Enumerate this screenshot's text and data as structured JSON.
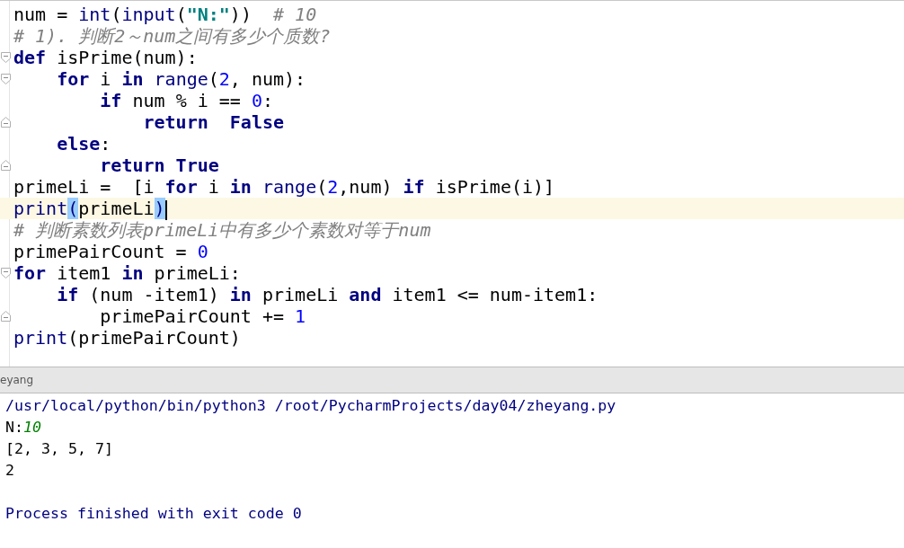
{
  "editor": {
    "lines": [
      {
        "kind": "plain",
        "tokens": [
          {
            "text": "num = ",
            "kind": "plain"
          },
          {
            "text": "int",
            "kind": "builtin"
          },
          {
            "text": "(",
            "kind": "plain"
          },
          {
            "text": "input",
            "kind": "builtin"
          },
          {
            "text": "(",
            "kind": "plain"
          },
          {
            "text": "\"N:\"",
            "kind": "string"
          },
          {
            "text": "))  ",
            "kind": "plain"
          },
          {
            "text": "# 10",
            "kind": "comment"
          }
        ]
      },
      {
        "kind": "plain",
        "tokens": [
          {
            "text": "# 1). 判断2～num之间有多少个质数?",
            "kind": "comment"
          }
        ]
      },
      {
        "kind": "fold-start",
        "tokens": [
          {
            "text": "def",
            "kind": "keyword"
          },
          {
            "text": " isPrime(num):",
            "kind": "plain"
          }
        ]
      },
      {
        "kind": "fold-start",
        "tokens": [
          {
            "text": "    for",
            "kind": "keyword"
          },
          {
            "text": " i ",
            "kind": "plain"
          },
          {
            "text": "in",
            "kind": "keyword"
          },
          {
            "text": " range",
            "kind": "builtin"
          },
          {
            "text": "(",
            "kind": "plain"
          },
          {
            "text": "2",
            "kind": "number"
          },
          {
            "text": ", num):",
            "kind": "plain"
          }
        ]
      },
      {
        "kind": "plain",
        "tokens": [
          {
            "text": "        if",
            "kind": "keyword"
          },
          {
            "text": " num % i == ",
            "kind": "plain"
          },
          {
            "text": "0",
            "kind": "number"
          },
          {
            "text": ":",
            "kind": "plain"
          }
        ]
      },
      {
        "kind": "fold-end",
        "tokens": [
          {
            "text": "            return",
            "kind": "keyword"
          },
          {
            "text": "  False",
            "kind": "keyword"
          }
        ]
      },
      {
        "kind": "plain",
        "tokens": [
          {
            "text": "    else",
            "kind": "keyword"
          },
          {
            "text": ":",
            "kind": "plain"
          }
        ]
      },
      {
        "kind": "fold-end",
        "tokens": [
          {
            "text": "        return",
            "kind": "keyword"
          },
          {
            "text": " True",
            "kind": "keyword"
          }
        ]
      },
      {
        "kind": "plain",
        "tokens": [
          {
            "text": "primeLi =  [i ",
            "kind": "plain"
          },
          {
            "text": "for",
            "kind": "keyword"
          },
          {
            "text": " i ",
            "kind": "plain"
          },
          {
            "text": "in",
            "kind": "keyword"
          },
          {
            "text": " range",
            "kind": "builtin"
          },
          {
            "text": "(",
            "kind": "plain"
          },
          {
            "text": "2",
            "kind": "number"
          },
          {
            "text": ",num) ",
            "kind": "plain"
          },
          {
            "text": "if",
            "kind": "keyword"
          },
          {
            "text": " isPrime(i)]",
            "kind": "plain"
          }
        ]
      },
      {
        "kind": "plain",
        "current": true,
        "tokens": [
          {
            "text": "print",
            "kind": "builtin"
          },
          {
            "text": "(",
            "kind": "brace-match"
          },
          {
            "text": "primeLi",
            "kind": "plain"
          },
          {
            "text": ")",
            "kind": "brace-match"
          }
        ]
      },
      {
        "kind": "plain",
        "tokens": [
          {
            "text": "# 判断素数列表primeLi中有多少个素数对等于num",
            "kind": "comment"
          }
        ]
      },
      {
        "kind": "plain",
        "tokens": [
          {
            "text": "primePairCount = ",
            "kind": "plain"
          },
          {
            "text": "0",
            "kind": "number"
          }
        ]
      },
      {
        "kind": "fold-start",
        "tokens": [
          {
            "text": "for",
            "kind": "keyword"
          },
          {
            "text": " item1 ",
            "kind": "plain"
          },
          {
            "text": "in",
            "kind": "keyword"
          },
          {
            "text": " primeLi:",
            "kind": "plain"
          }
        ]
      },
      {
        "kind": "plain",
        "tokens": [
          {
            "text": "    if",
            "kind": "keyword"
          },
          {
            "text": " (num -item1) ",
            "kind": "plain"
          },
          {
            "text": "in",
            "kind": "keyword"
          },
          {
            "text": " primeLi ",
            "kind": "plain"
          },
          {
            "text": "and",
            "kind": "keyword"
          },
          {
            "text": " item1 <= num-item1:",
            "kind": "plain"
          }
        ]
      },
      {
        "kind": "fold-end",
        "tokens": [
          {
            "text": "        primePairCount += ",
            "kind": "plain"
          },
          {
            "text": "1",
            "kind": "number"
          }
        ]
      },
      {
        "kind": "plain",
        "tokens": [
          {
            "text": "print",
            "kind": "builtin"
          },
          {
            "text": "(primePairCount)",
            "kind": "plain"
          }
        ]
      }
    ]
  },
  "run_panel": {
    "tab_title": "eyang",
    "lines": [
      {
        "kind": "output",
        "tokens": [
          {
            "text": "/usr/local/python/bin/python3 /root/PycharmProjects/day04/zheyang.py",
            "kind": "system"
          }
        ]
      },
      {
        "kind": "output",
        "tokens": [
          {
            "text": "N:",
            "kind": "plain"
          },
          {
            "text": "10",
            "kind": "input"
          }
        ]
      },
      {
        "kind": "output",
        "tokens": [
          {
            "text": "[2, 3, 5, 7]",
            "kind": "plain"
          }
        ]
      },
      {
        "kind": "output",
        "tokens": [
          {
            "text": "2",
            "kind": "plain"
          }
        ]
      },
      {
        "kind": "blank"
      },
      {
        "kind": "output",
        "tokens": [
          {
            "text": "Process finished with exit code 0",
            "kind": "system"
          }
        ]
      }
    ]
  }
}
